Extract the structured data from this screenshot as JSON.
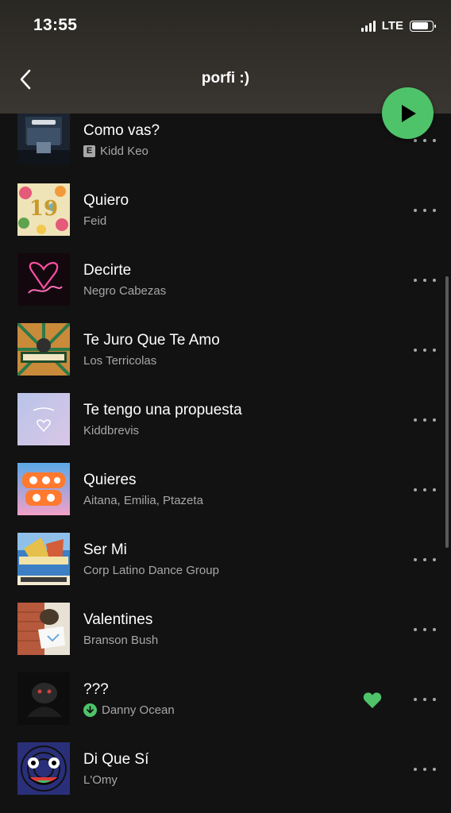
{
  "status": {
    "time": "13:55",
    "network": "LTE"
  },
  "header": {
    "title": "porfi :)"
  },
  "colors": {
    "accent": "#4fc36a",
    "background": "#121212",
    "secondary_text": "#a7a7a7"
  },
  "icons": {
    "back": "chevron-left-icon",
    "play": "play-icon",
    "more": "more-horizontal-icon",
    "liked": "heart-icon",
    "downloaded": "download-icon",
    "explicit": "explicit-icon"
  },
  "tracks": [
    {
      "title": "Como vas?",
      "artist": "Kidd Keo",
      "explicit_label": "E"
    },
    {
      "title": "Quiero",
      "artist": "Feid"
    },
    {
      "title": "Decirte",
      "artist": "Negro Cabezas"
    },
    {
      "title": "Te Juro Que Te Amo",
      "artist": "Los Terricolas"
    },
    {
      "title": "Te tengo una propuesta",
      "artist": "Kiddbrevis"
    },
    {
      "title": "Quieres",
      "artist": "Aitana, Emilia, Ptazeta"
    },
    {
      "title": "Ser Mi",
      "artist": "Corp Latino Dance Group"
    },
    {
      "title": "Valentines",
      "artist": "Branson Bush"
    },
    {
      "title": "???",
      "artist": "Danny Ocean",
      "liked": true,
      "downloaded": true
    },
    {
      "title": "Di Que Sí",
      "artist": "L'Omy"
    }
  ]
}
